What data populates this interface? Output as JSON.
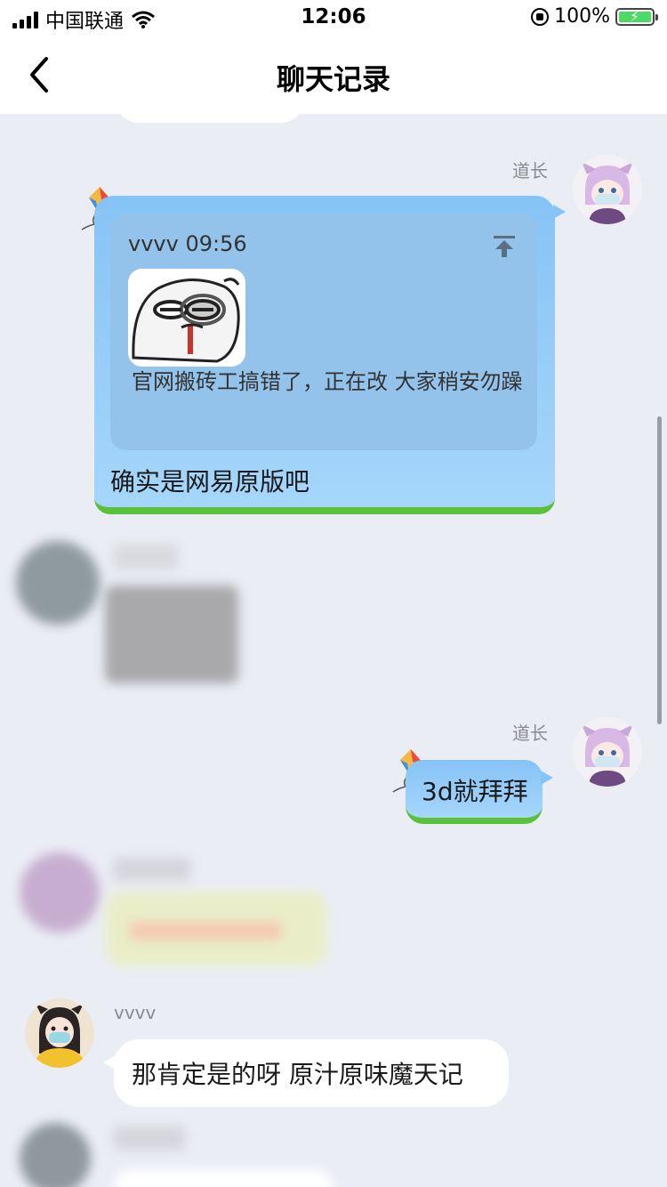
{
  "status_bar": {
    "carrier": "中国联通",
    "time": "12:06",
    "battery": "100%"
  },
  "nav": {
    "title": "聊天记录"
  },
  "messages": {
    "m1": {
      "sender": "道长",
      "quote_meta": "vvvv 09:56",
      "quote_text": "官网搬砖工搞错了，正在改 大家稍安勿躁",
      "reply": "确实是网易原版吧"
    },
    "m2": {
      "sender": "道长",
      "text": "3d就拜拜"
    },
    "m3": {
      "sender": "vvvv",
      "text": "那肯定是的呀 原汁原味魔天记"
    }
  },
  "colors": {
    "sent_bubble": "#a6d6fb",
    "grass": "#5ac13a",
    "background": "#ebedf5"
  }
}
